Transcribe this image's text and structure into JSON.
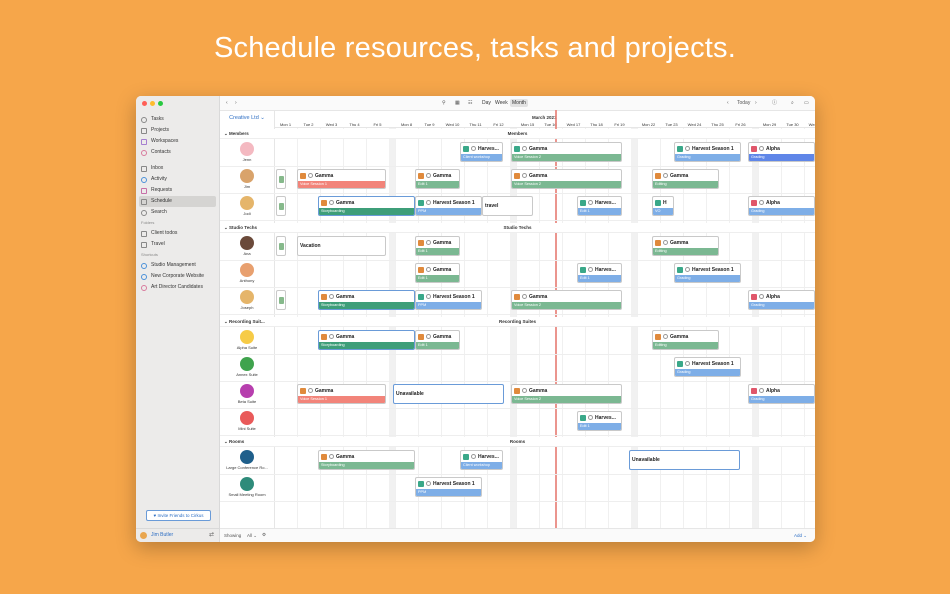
{
  "headline": "Schedule resources, tasks and projects.",
  "colors": {
    "background": "#F6A64A",
    "voice_session": "#F2847A",
    "edit": "#7EAEE7",
    "storyboarding": "#3E9E79",
    "green_light": "#7BB892",
    "grading": "#7EAEE7",
    "alpha_grading": "#5F86E8",
    "client_workshop": "#7EAEE7",
    "today_line": "#E8837A"
  },
  "sidebar": {
    "items": [
      {
        "label": "Tasks",
        "icon": "circle-icon"
      },
      {
        "label": "Projects",
        "icon": "folder-icon"
      },
      {
        "label": "Workspaces",
        "icon": "grid-icon"
      },
      {
        "label": "Contacts",
        "icon": "person-icon"
      },
      {
        "label": "Inbox",
        "icon": "inbox-icon"
      },
      {
        "label": "Activity",
        "icon": "activity-icon"
      },
      {
        "label": "Requests",
        "icon": "request-icon"
      },
      {
        "label": "Schedule",
        "icon": "calendar-icon"
      },
      {
        "label": "Search",
        "icon": "search-icon"
      }
    ],
    "folders_header": "Folders",
    "folders": [
      {
        "label": "Client todos"
      },
      {
        "label": "Travel"
      }
    ],
    "shortcuts_header": "Shortcuts",
    "shortcuts": [
      {
        "label": "Studio Management"
      },
      {
        "label": "New Corporate Website"
      },
      {
        "label": "Art Director Candidates"
      }
    ],
    "invite_label": "Invite Friends to Cirkus",
    "user_name": "Jim Butler"
  },
  "toolbar": {
    "view_day": "Day",
    "view_week": "Week",
    "view_month": "Month",
    "today_label": "Today"
  },
  "org_selector": "Creative Ltd",
  "month_label": "March 2021",
  "dates": [
    "Mon 1",
    "Tue 2",
    "Wed 3",
    "Thu 4",
    "Fri 5",
    "",
    "Mon 8",
    "Tue 9",
    "Wed 10",
    "Thu 11",
    "Fri 12",
    "",
    "Mon 15",
    "Tue 16",
    "Wed 17",
    "Thu 18",
    "Fri 19",
    "",
    "Mon 22",
    "Tue 23",
    "Wed 24",
    "Thu 25",
    "Fri 26",
    "",
    "Mon 29",
    "Tue 30",
    "Wed 31"
  ],
  "sections": {
    "members": "Members",
    "studio_techs": "Studio Techs",
    "recording_short": "Recording Suit...",
    "recording": "Recording Suites",
    "rooms": "Rooms"
  },
  "resources": {
    "jenn": "Jenn",
    "jim": "Jim",
    "jodi": "Jodi",
    "ana": "Ana",
    "anthony": "Anthony",
    "joseph": "Joseph",
    "alpha_suite": "Alpha Suite",
    "annex_suite": "Annex Suite",
    "beta_suite": "Beta Suite",
    "mini_suite": "Mini Suite",
    "large_conf": "Large Conference Ro...",
    "small_meeting": "Small Meeting Room"
  },
  "tasks": {
    "harvest_short": "Harves...",
    "harvest": "Harvest Season 1",
    "gamma": "Gamma",
    "alpha": "Alpha",
    "travel": "travel",
    "vacation": "Vacation",
    "unavailable": "Unavailable",
    "client_workshop": "Client workshop",
    "voice_session_2": "Voice Session 2",
    "voice_session_1": "Voice Session 1",
    "grading": "Grading",
    "edit_1": "Edit 1",
    "editing": "Editing",
    "storyboarding": "Storyboarding",
    "ppm": "PPM",
    "vo": "VO",
    "harv_tiny": "H"
  },
  "footer": {
    "showing_label": "Showing",
    "showing_value": "All",
    "add_label": "Add"
  }
}
